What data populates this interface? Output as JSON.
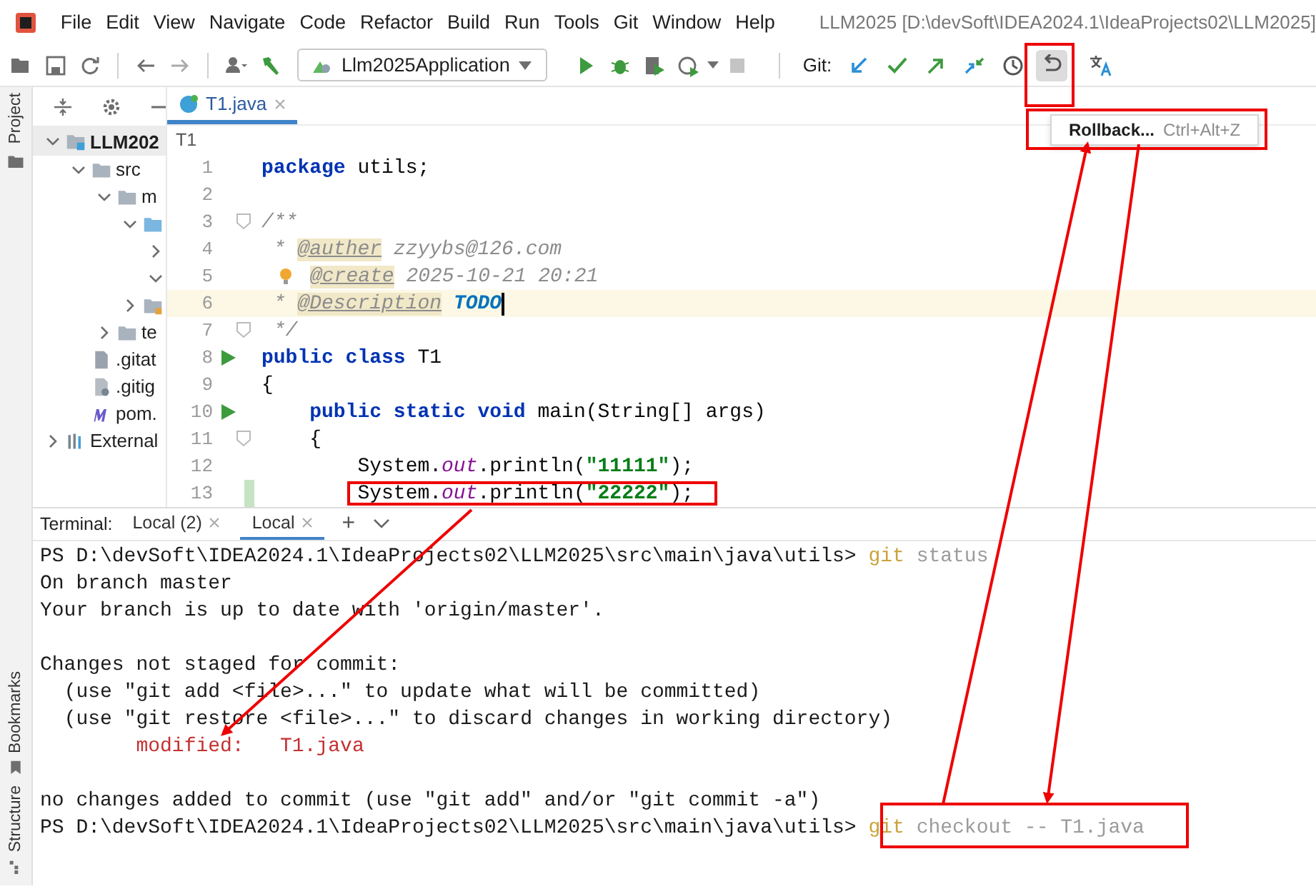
{
  "menu_bar": {
    "items": [
      "File",
      "Edit",
      "View",
      "Navigate",
      "Code",
      "Refactor",
      "Build",
      "Run",
      "Tools",
      "Git",
      "Window",
      "Help"
    ],
    "title": "LLM2025 [D:\\devSoft\\IDEA2024.1\\IdeaProjects02\\LLM2025]"
  },
  "toolbar": {
    "run_config": "Llm2025Application",
    "git_label": "Git:",
    "rollback_active": true
  },
  "rollback_menu": {
    "label": "Rollback...",
    "shortcut": "Ctrl+Alt+Z"
  },
  "side_stripe": {
    "top": [
      "Project"
    ],
    "bottom": [
      "Bookmarks",
      "Structure"
    ]
  },
  "project_tree": {
    "items": [
      {
        "kind": "module",
        "label": "LLM202",
        "expanded": true,
        "children": [
          {
            "kind": "folder",
            "label": "src",
            "expanded": true,
            "children": [
              {
                "kind": "folder",
                "label": "m",
                "expanded": true,
                "children": [
                  {
                    "kind": "source",
                    "expanded": true,
                    "children": [
                      {
                        "expanded": false
                      },
                      {
                        "expanded": true
                      }
                    ]
                  },
                  {
                    "kind": "resources",
                    "expanded": false
                  }
                ]
              },
              {
                "kind": "folder",
                "label": "te",
                "expanded": false
              }
            ]
          },
          {
            "kind": "file",
            "label": ".gitat"
          },
          {
            "kind": "git-file",
            "label": ".gitig"
          },
          {
            "kind": "maven",
            "label": "pom."
          }
        ]
      },
      {
        "kind": "library",
        "label": "External",
        "expanded": false
      }
    ]
  },
  "editor": {
    "tabs": [
      {
        "label": "T1.java",
        "selected": true
      }
    ],
    "breadcrumb": "T1",
    "lines": [
      {
        "number": "1",
        "tokens": [
          {
            "kind": "keyword",
            "text": "package"
          },
          {
            "kind": "plain",
            "text": " utils;"
          }
        ]
      },
      {
        "number": "2"
      },
      {
        "number": "3",
        "fold": true,
        "tokens": [
          {
            "kind": "comment",
            "text": "/**"
          }
        ]
      },
      {
        "number": "4",
        "tokens": [
          {
            "kind": "comment",
            "text": " * "
          },
          {
            "kind": "doc_tag",
            "text": "@auther"
          },
          {
            "kind": "comment",
            "text": " zzyybs@126.com"
          }
        ]
      },
      {
        "number": "5",
        "tokens": [
          {
            "kind": "bulb"
          },
          {
            "kind": "doc_tag",
            "text": "@create"
          },
          {
            "kind": "comment",
            "text": " 2025-10-21 20:21"
          }
        ]
      },
      {
        "number": "6",
        "current": true,
        "caret": true,
        "tokens": [
          {
            "kind": "comment",
            "text": " * "
          },
          {
            "kind": "doc_tag",
            "text": "@Description"
          },
          {
            "kind": "todo",
            "text": " TODO"
          }
        ]
      },
      {
        "number": "7",
        "fold": true,
        "tokens": [
          {
            "kind": "comment",
            "text": " */"
          }
        ]
      },
      {
        "number": "8",
        "run": true,
        "tokens": [
          {
            "kind": "keyword",
            "text": "public class"
          },
          {
            "kind": "plain",
            "text": " T1"
          }
        ]
      },
      {
        "number": "9",
        "tokens": [
          {
            "kind": "plain",
            "text": "{"
          }
        ]
      },
      {
        "number": "10",
        "run": true,
        "tokens": [
          {
            "kind": "keyword",
            "text": "    public static void"
          },
          {
            "kind": "plain",
            "text": " main(String[] args)"
          }
        ]
      },
      {
        "number": "11",
        "fold": true,
        "tokens": [
          {
            "kind": "plain",
            "text": "    {"
          }
        ]
      },
      {
        "number": "12",
        "tokens": [
          {
            "kind": "plain",
            "text": "        System."
          },
          {
            "kind": "field",
            "text": "out"
          },
          {
            "kind": "plain",
            "text": ".println("
          },
          {
            "kind": "string",
            "text": "\"11111\""
          },
          {
            "kind": "plain",
            "text": ");"
          }
        ]
      },
      {
        "number": "13",
        "changed": true,
        "tokens": [
          {
            "kind": "plain",
            "text": "        System."
          },
          {
            "kind": "field",
            "text": "out"
          },
          {
            "kind": "plain",
            "text": ".println("
          },
          {
            "kind": "string",
            "text": "\"22222\""
          },
          {
            "kind": "plain",
            "text": ");"
          }
        ]
      }
    ]
  },
  "terminal": {
    "label": "Terminal:",
    "tabs": [
      {
        "label": "Local (2)",
        "selected": false
      },
      {
        "label": "Local",
        "selected": true
      }
    ],
    "add": "+",
    "blocks": [
      [
        [
          {
            "kind": "plain",
            "text": "PS D:\\devSoft\\IDEA2024.1\\IdeaProjects02\\LLM2025\\src\\main\\java\\utils> "
          },
          {
            "kind": "cmd",
            "text": "git"
          },
          {
            "kind": "arg",
            "text": " status"
          }
        ],
        [
          {
            "kind": "plain",
            "text": "On branch master"
          }
        ],
        [
          {
            "kind": "plain",
            "text": "Your branch is up to date with 'origin/master'."
          }
        ]
      ],
      [
        [
          {
            "kind": "plain",
            "text": "Changes not staged for commit:"
          }
        ],
        [
          {
            "kind": "plain",
            "text": "  (use \"git add <file>...\" to update what will be committed)"
          }
        ],
        [
          {
            "kind": "plain",
            "text": "  (use \"git restore <file>...\" to discard changes in working directory)"
          }
        ],
        [
          {
            "kind": "modified",
            "text": "        modified:   T1.java"
          }
        ]
      ],
      [
        [
          {
            "kind": "plain",
            "text": "no changes added to commit (use \"git add\" and/or \"git commit -a\")"
          }
        ],
        [
          {
            "kind": "plain",
            "text": "PS D:\\devSoft\\IDEA2024.1\\IdeaProjects02\\LLM2025\\src\\main\\java\\utils> "
          },
          {
            "kind": "cmd",
            "text": "git"
          },
          {
            "kind": "arg",
            "text": " checkout -- T1.java"
          }
        ]
      ]
    ]
  }
}
